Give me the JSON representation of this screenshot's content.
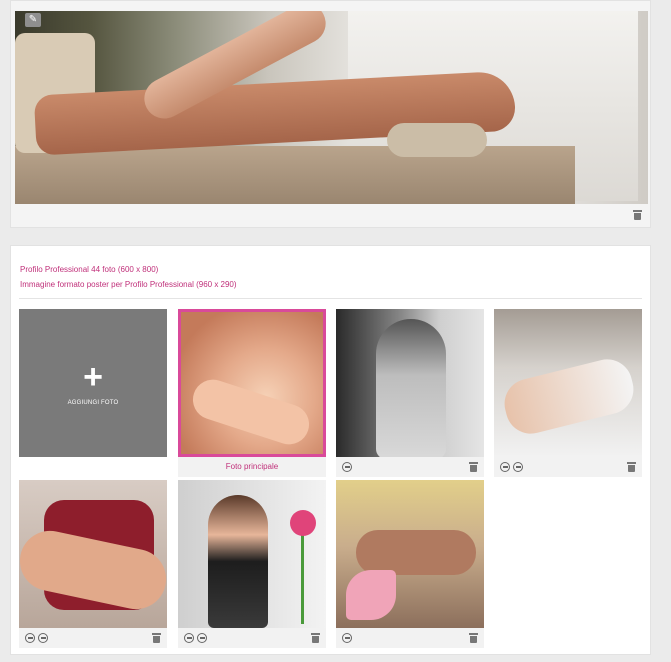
{
  "poster": {
    "edit_icon": "edit-icon",
    "delete_icon": "trash-icon"
  },
  "gallery": {
    "info_line_1": "Profilo Professional 44 foto (600 x 800)",
    "info_line_2": "Immagine formato poster per Profilo Professional (960 x 290)",
    "add_photo_label": "AGGIUNGI FOTO",
    "main_photo_label": "Foto principale",
    "accent_color": "#c0307a",
    "main_border_color": "#d94a9a",
    "photos": [
      {
        "id": "photo-1",
        "main": true
      },
      {
        "id": "photo-2",
        "main": false
      },
      {
        "id": "photo-3",
        "main": false
      },
      {
        "id": "photo-4",
        "main": false
      },
      {
        "id": "photo-5",
        "main": false
      },
      {
        "id": "photo-6",
        "main": false
      }
    ]
  }
}
